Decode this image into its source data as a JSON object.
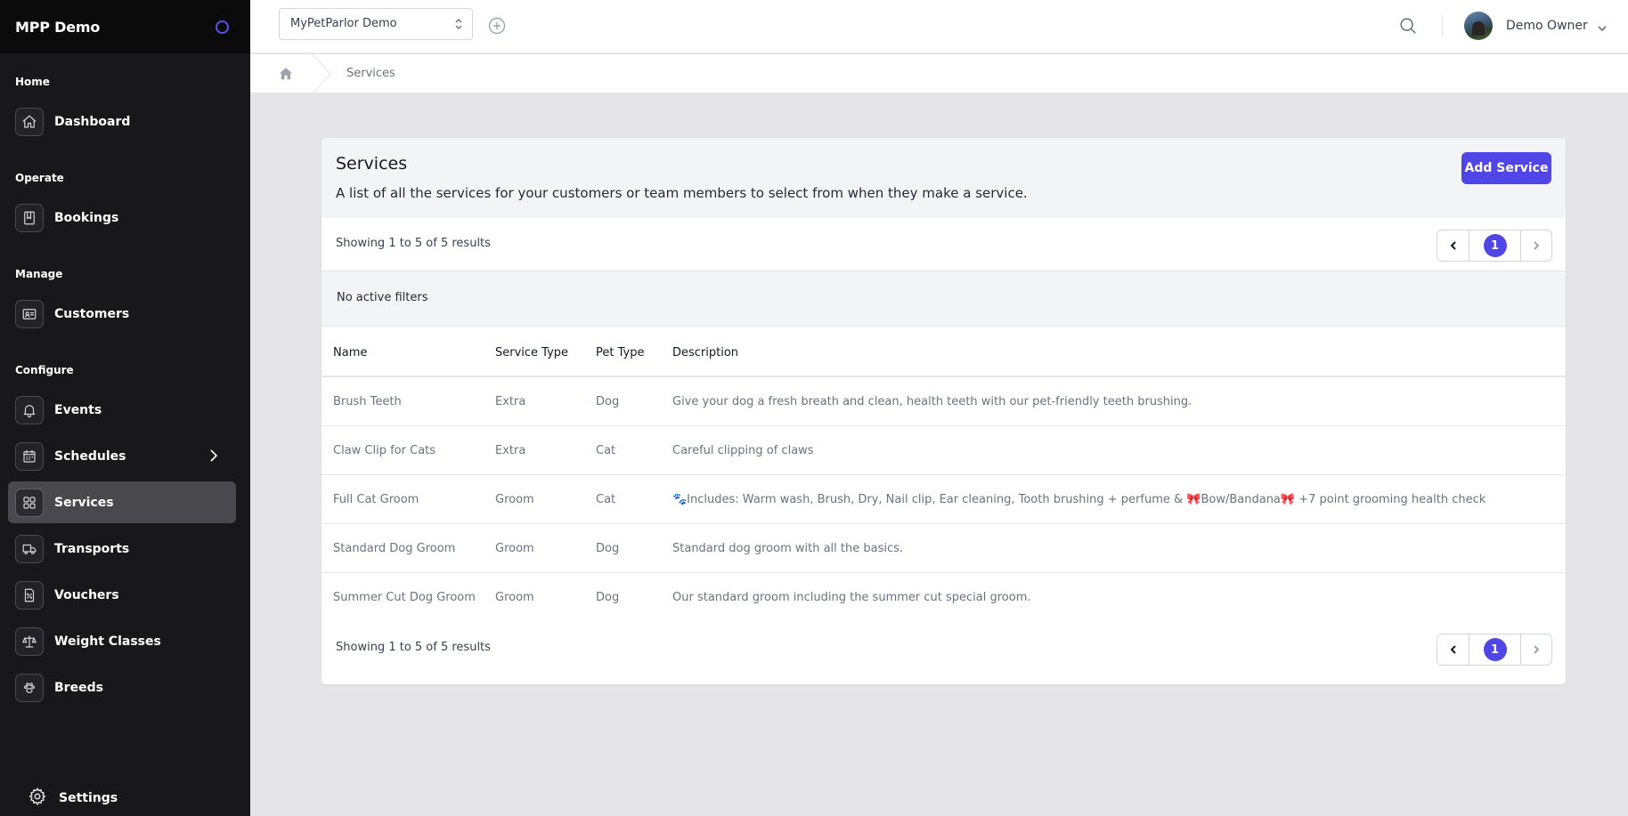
{
  "app": {
    "title": "MPP Demo"
  },
  "sidebar": {
    "sections": {
      "home": "Home",
      "operate": "Operate",
      "manage": "Manage",
      "configure": "Configure"
    },
    "items": [
      {
        "label": "Dashboard",
        "icon": "home-icon"
      },
      {
        "label": "Bookings",
        "icon": "book-icon"
      },
      {
        "label": "Customers",
        "icon": "id-card-icon"
      },
      {
        "label": "Events",
        "icon": "bell-icon"
      },
      {
        "label": "Schedules",
        "icon": "calendar-icon"
      },
      {
        "label": "Services",
        "icon": "grid-icon"
      },
      {
        "label": "Transports",
        "icon": "truck-icon"
      },
      {
        "label": "Vouchers",
        "icon": "voucher-icon"
      },
      {
        "label": "Weight Classes",
        "icon": "scale-icon"
      },
      {
        "label": "Breeds",
        "icon": "paw-icon"
      }
    ],
    "active": "Services",
    "settings_label": "Settings"
  },
  "topbar": {
    "org_selected": "MyPetParlor Demo",
    "user_name": "Demo Owner"
  },
  "breadcrumb": {
    "current": "Services"
  },
  "page": {
    "title": "Services",
    "subtitle": "A list of all the services for your customers or team members to select from when they make a service.",
    "add_button": "Add Service",
    "results_text": "Showing 1 to 5 of 5 results",
    "current_page": "1",
    "filters_text": "No active filters"
  },
  "table": {
    "columns": [
      "Name",
      "Service Type",
      "Pet Type",
      "Description"
    ],
    "rows": [
      {
        "name": "Brush Teeth",
        "service_type": "Extra",
        "pet_type": "Dog",
        "description": "Give your dog a fresh breath and clean, health teeth with our pet-friendly teeth brushing."
      },
      {
        "name": "Claw Clip for Cats",
        "service_type": "Extra",
        "pet_type": "Cat",
        "description": "Careful clipping of claws"
      },
      {
        "name": "Full Cat Groom",
        "service_type": "Groom",
        "pet_type": "Cat",
        "description": "🐾Includes: Warm wash, Brush, Dry, Nail clip, Ear cleaning, Tooth brushing + perfume & 🎀Bow/Bandana🎀 +7 point grooming health check"
      },
      {
        "name": "Standard Dog Groom",
        "service_type": "Groom",
        "pet_type": "Dog",
        "description": "Standard dog groom with all the basics."
      },
      {
        "name": "Summer Cut Dog Groom",
        "service_type": "Groom",
        "pet_type": "Dog",
        "description": "Our standard groom including the summer cut special groom."
      }
    ]
  },
  "colors": {
    "sidebar_bg": "#18181b",
    "brand_bg": "#0b0b0c",
    "active_item_bg": "#48484d",
    "accent": "#4f46e5",
    "content_bg": "#e5e5e7"
  }
}
